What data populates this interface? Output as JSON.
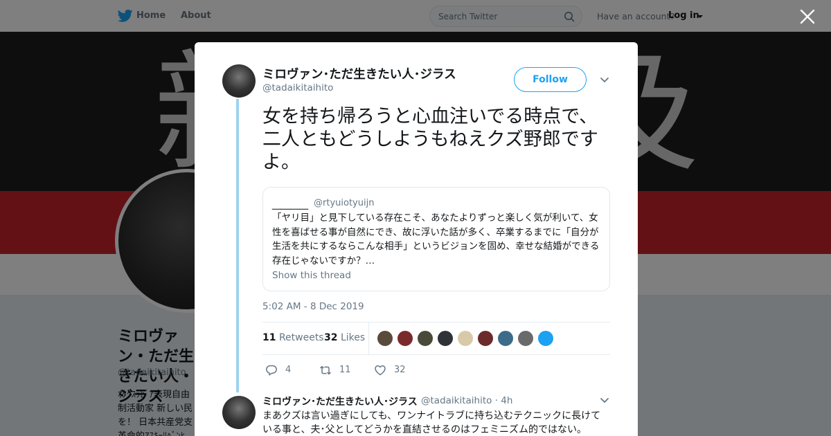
{
  "topbar": {
    "home_label": "Home",
    "about_label": "About",
    "search_placeholder": "Search Twitter",
    "account_question": "Have an account?",
    "login_label": "Log in"
  },
  "banner": {
    "chars": [
      "新",
      "及"
    ]
  },
  "background_profile": {
    "name": "ミロヴァン・ただ生きたい人・ジラス",
    "handle": "@tadaikitaihito",
    "bio_lines": [
      "ｵﾀｸｽﾗﾋﾞｱ表現自由",
      "制活動家 新しい民",
      "を！ 日本共産党支",
      "革命的ｱｽｷｰﾘﾍﾞﾝﾋ"
    ]
  },
  "modal": {
    "author": {
      "name": "ミロヴァン･ただ生きたい人･ジラス",
      "handle": "@tadaikitaihito"
    },
    "follow_label": "Follow",
    "tweet_text": "女を持ち帰ろうと心血注いでる時点で、二人ともどうしようもねえクズ野郎ですよ。",
    "quote": {
      "name": "＿＿＿＿",
      "handle": "@rtyuiotyuijn",
      "text": "「ヤリ目」と見下している存在こそ、あなたよりずっと楽しく気が利いて、女性を喜ばせる事が自然にでき、故に浮いた話が多く、卒業するまでに「自分が生活を共にするならこんな相手」というビジョンを固め、幸せな結婚ができる存在じゃないですか？…",
      "show_thread": "Show this thread"
    },
    "timestamp": "5:02 AM - 8 Dec 2019",
    "stats": {
      "retweets_count": "11",
      "retweets_label": "Retweets",
      "likes_count": "32",
      "likes_label": "Likes"
    },
    "likers": [
      "#5a4a3c",
      "#7a2a2a",
      "#4a4a3a",
      "#2f3338",
      "#d8c9a8",
      "#6b2b2b",
      "#3d6b8a",
      "#6a6a6a",
      "#1da1f2"
    ],
    "actions": {
      "replies": "4",
      "retweets": "11",
      "likes": "32"
    },
    "reply": {
      "name": "ミロヴァン･ただ生きたい人･ジラス",
      "handle": "@tadaikitaihito · 4h",
      "text": "まあクズは言い過ぎにしても、ワンナイトラブに持ち込むテクニックに長けている事と、夫･父としてどうかを直結させるのはフェミニズム的ではない。"
    }
  },
  "colors": {
    "accent": "#1da1f2",
    "thread_line": "#9ed3f0",
    "banner_red": "#c8222b"
  },
  "icons": [
    "twitter-bird-icon",
    "search-icon",
    "close-icon",
    "chevron-down-icon",
    "reply-icon",
    "retweet-icon",
    "heart-icon"
  ]
}
